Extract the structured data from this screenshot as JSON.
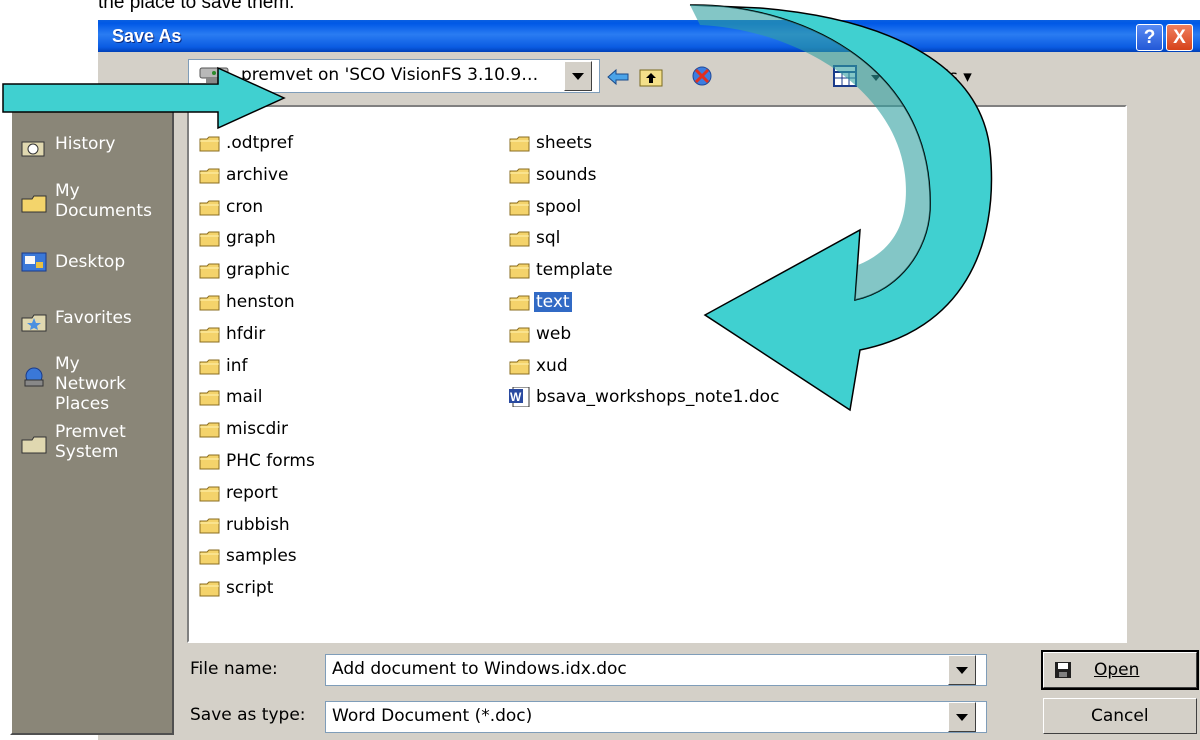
{
  "caption": "the place to save them.",
  "dialog": {
    "title": "Save As",
    "help_glyph": "?",
    "close_glyph": "X"
  },
  "toolbar": {
    "look_in_value": "premvet on 'SCO VisionFS 3.10.9…",
    "tools_label": "Tools ▾"
  },
  "places": [
    {
      "label": "History",
      "icon": "history-icon"
    },
    {
      "label": "My\nDocuments",
      "icon": "my-documents-icon"
    },
    {
      "label": "Desktop",
      "icon": "desktop-icon"
    },
    {
      "label": "Favorites",
      "icon": "favorites-icon"
    },
    {
      "label": "My Network\nPlaces",
      "icon": "network-places-icon"
    },
    {
      "label": "Premvet\nSystem",
      "icon": "folder-icon"
    }
  ],
  "files": {
    "column1": [
      ".odtpref",
      "archive",
      "cron",
      "graph",
      "graphic",
      "henston",
      "hfdir",
      "inf",
      "mail",
      "miscdir",
      "PHC forms",
      "report",
      "rubbish",
      "samples",
      "script"
    ],
    "column2": [
      "sheets",
      "sounds",
      "spool",
      "sql",
      "template",
      "text",
      "web",
      "xud",
      "bsava_workshops_note1.doc"
    ],
    "selected": "text"
  },
  "bottom": {
    "file_name_label": "File name:",
    "file_name_value": "Add document to Windows.idx.doc",
    "save_type_label": "Save as type:",
    "save_type_value": "Word Document (*.doc)",
    "open_label": "Open",
    "cancel_label": "Cancel"
  },
  "colors": {
    "arrow_fill": "#40d0d0",
    "titlebar": "#0058e6",
    "places_bg": "#8a8678",
    "selection": "#316ac5"
  }
}
